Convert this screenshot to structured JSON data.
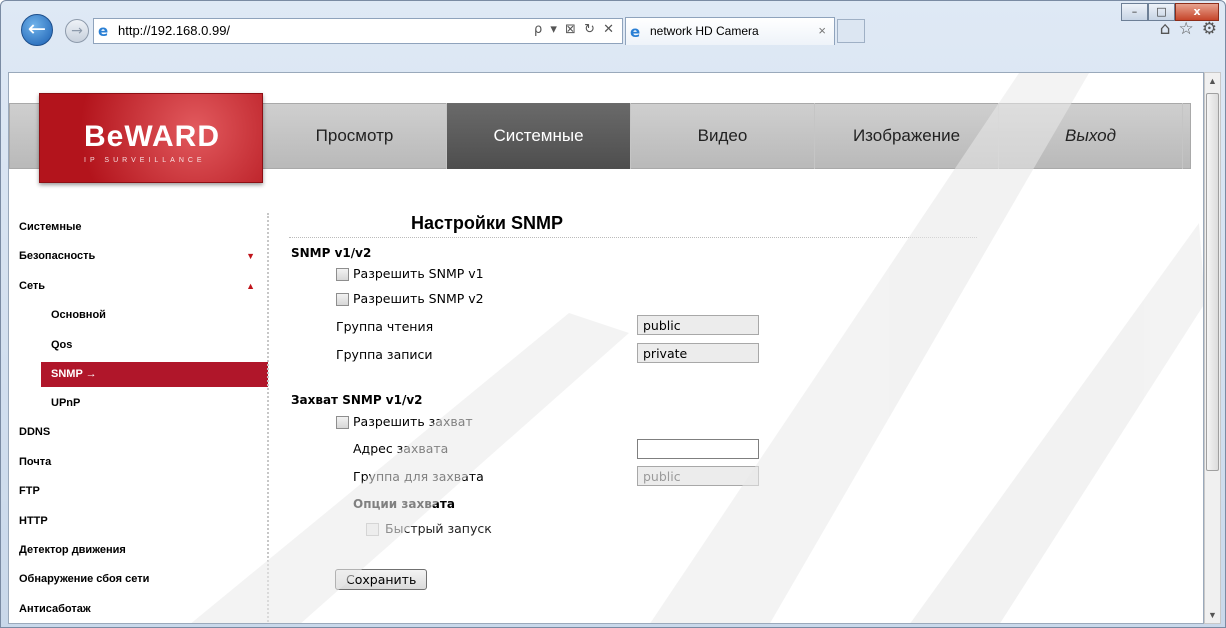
{
  "browser": {
    "address": "http://192.168.0.99/",
    "tab_title": "network HD Camera",
    "addr_tools": "ρ ▾ ⊠ ↻ ✕",
    "tab_close": "×",
    "win_min": "–",
    "win_max": "□",
    "win_close": "x",
    "back_glyph": "←",
    "fwd_glyph": "→",
    "home_glyph": "⌂",
    "star_glyph": "☆",
    "gear_glyph": "⚙"
  },
  "logo": {
    "text": "BeWARD",
    "sub": "IP SURVEILLANCE"
  },
  "nav": [
    "Просмотр",
    "Системные",
    "Видео",
    "Изображение",
    "Выход"
  ],
  "sidebar": {
    "items": [
      {
        "label": "Системные"
      },
      {
        "label": "Безопасность",
        "arrow": "▼"
      },
      {
        "label": "Сеть",
        "arrow": "▲"
      },
      {
        "label": "Основной"
      },
      {
        "label": "Qos"
      },
      {
        "label": "SNMP →"
      },
      {
        "label": "UPnP"
      },
      {
        "label": "DDNS"
      },
      {
        "label": "Почта"
      },
      {
        "label": "FTP"
      },
      {
        "label": "HTTP"
      },
      {
        "label": "Детектор движения"
      },
      {
        "label": "Обнаружение сбоя сети"
      },
      {
        "label": "Антисаботаж"
      }
    ]
  },
  "main": {
    "title": "Настройки SNMP",
    "snmp_section": "SNMP v1/v2",
    "enable_v1": "Разрешить SNMP v1",
    "enable_v2": "Разрешить SNMP v2",
    "read_group_label": "Группа чтения",
    "read_group_value": "public",
    "write_group_label": "Группа записи",
    "write_group_value": "private",
    "trap_section": "Захват SNMP v1/v2",
    "enable_trap": "Разрешить захват",
    "trap_address_label": "Адрес захвата",
    "trap_address_value": "",
    "trap_group_label": "Группа для захвата",
    "trap_group_value": "public",
    "trap_options": "Опции захвата",
    "quick_start": "Быстрый запуск",
    "save": "Сохранить"
  },
  "colors": {
    "accent": "#b0162a",
    "nav_active": "#555555"
  }
}
